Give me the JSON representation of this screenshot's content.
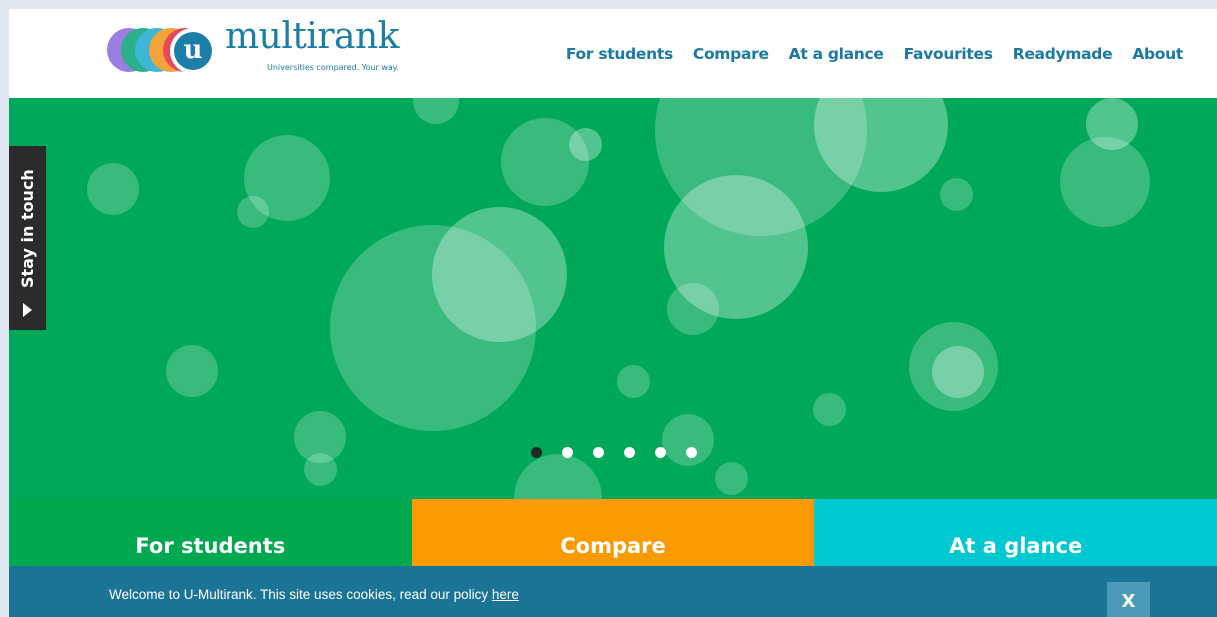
{
  "brand": {
    "name": "multirank",
    "badge_letter": "u",
    "tagline": "Universities compared. Your way.",
    "circle_colors": [
      "#9b7fe0",
      "#2ab08a",
      "#3fb5d8",
      "#f2a33a",
      "#e8485a"
    ]
  },
  "nav": {
    "items": [
      "For students",
      "Compare",
      "At a glance",
      "Favourites",
      "Readymade",
      "About"
    ]
  },
  "sidebar_tab": {
    "label": "Stay in touch",
    "icon": "play-arrow-icon"
  },
  "hero": {
    "background_color": "#00a859",
    "carousel": {
      "slide_count": 6,
      "active_index": 0
    }
  },
  "tiles": [
    {
      "label": "For students",
      "color": "#00a84f"
    },
    {
      "label": "Compare",
      "color": "#f99a00"
    },
    {
      "label": "At a glance",
      "color": "#00c8d0"
    }
  ],
  "cookie_bar": {
    "text": "Welcome to U-Multirank. This site uses cookies, read our policy ",
    "link_text": "here",
    "close_label": "X"
  }
}
